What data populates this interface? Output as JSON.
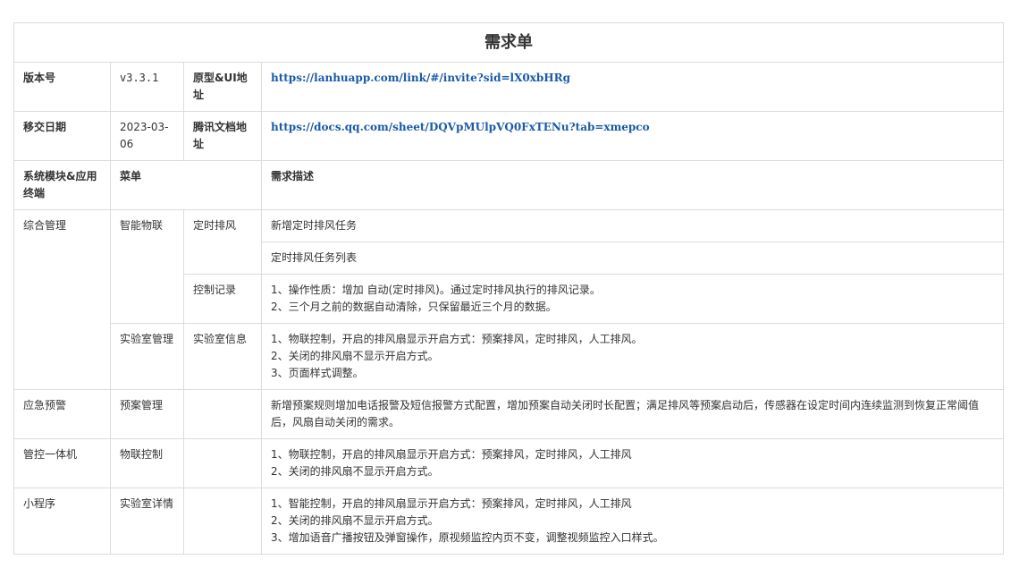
{
  "title": "需求单",
  "header": {
    "version_label": "版本号",
    "version_value": "v3.3.1",
    "proto_label": "原型&UI地址",
    "proto_url": "https://lanhuapp.com/link/#/invite?sid=lX0xbHRg",
    "date_label": "移交日期",
    "date_value": "2023-03-06",
    "tencent_label": "腾讯文档地址",
    "tencent_url": "https://docs.qq.com/sheet/DQVpMUlpVQ0FxTENu?tab=xmepco",
    "module_label": "系统模块&应用终端",
    "menu_label": "菜单",
    "desc_label": "需求描述"
  },
  "rows": {
    "r1": {
      "module": "综合管理",
      "menu1": "智能物联",
      "menu2": "定时排风",
      "desc": "新增定时排风任务"
    },
    "r2": {
      "desc": "定时排风任务列表"
    },
    "r3": {
      "menu2": "控制记录",
      "lines": [
        "1、操作性质：增加 自动(定时排风)。通过定时排风执行的排风记录。",
        "2、三个月之前的数据自动清除，只保留最近三个月的数据。"
      ]
    },
    "r4": {
      "menu1": "实验室管理",
      "menu2": "实验室信息",
      "lines": [
        "1、物联控制，开启的排风扇显示开启方式：预案排风，定时排风，人工排风。",
        "2、关闭的排风扇不显示开启方式。",
        "3、页面样式调整。"
      ]
    },
    "r5": {
      "module": "应急预警",
      "menu1": "预案管理",
      "desc": "新增预案规则增加电话报警及短信报警方式配置，增加预案自动关闭时长配置；满足排风等预案启动后，传感器在设定时间内连续监测到恢复正常阈值后，风扇自动关闭的需求。"
    },
    "r6": {
      "module": "管控一体机",
      "menu1": "物联控制",
      "lines": [
        "1、物联控制，开启的排风扇显示开启方式：预案排风，定时排风，人工排风",
        "2、关闭的排风扇不显示开启方式。"
      ]
    },
    "r7": {
      "module": "小程序",
      "menu1": "实验室详情",
      "lines": [
        "1、智能控制，开启的排风扇显示开启方式：预案排风，定时排风，人工排风",
        "2、关闭的排风扇不显示开启方式。",
        "3、增加语音广播按钮及弹窗操作，原视频监控内页不变，调整视频监控入口样式。"
      ]
    }
  }
}
